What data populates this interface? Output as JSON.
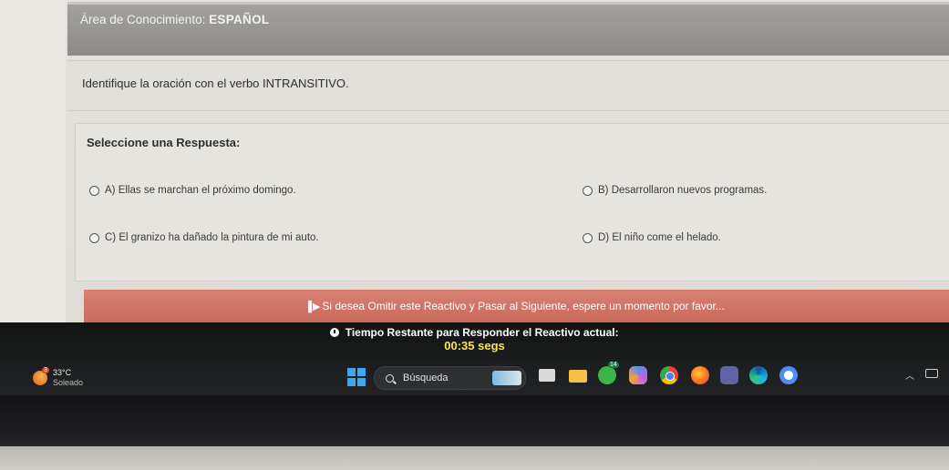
{
  "exam": {
    "area_label": "Área de Conocimiento:",
    "area_value": "ESPAÑOL",
    "question": "Identifique la oración con el verbo INTRANSITIVO.",
    "answers_heading": "Seleccione una Respuesta:",
    "options": [
      {
        "text": "A) Ellas se marchan el próximo domingo."
      },
      {
        "text": "B) Desarrollaron nuevos programas."
      },
      {
        "text": "C) El granizo ha dañado la pintura de mi auto."
      },
      {
        "text": "D) El niño come el helado."
      }
    ],
    "skip_text": "Si desea Omitir este Reactivo y Pasar al Siguiente, espere un momento por favor...",
    "timer_label": "Tiempo Restante para Responder el Reactivo actual:",
    "timer_value": "00:35 segs"
  },
  "taskbar": {
    "weather_temp": "33°C",
    "weather_condition": "Soleado",
    "weather_badge": "3",
    "search_label": "Búsqueda",
    "whatsapp_badge": "14"
  },
  "colors": {
    "header_bg": "#9a9894",
    "skip_bar": "#cf7667",
    "timer_value": "#ffe14a",
    "taskbar_bg": "#1e2022"
  }
}
